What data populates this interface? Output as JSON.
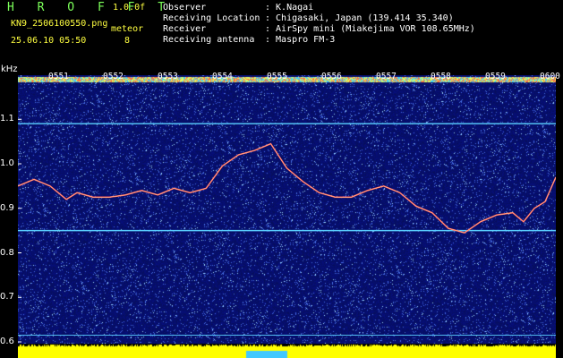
{
  "header": {
    "app_title": "H R O F F T",
    "version": "1.0.0f",
    "file_name": "KN9_2506100550.png",
    "datetime": "25.06.10 05:50",
    "meteor_label": "meteor",
    "meteor_count": "8",
    "info": [
      {
        "label": "Observer",
        "value": ": K.Nagai"
      },
      {
        "label": "Receiving Location",
        "value": ": Chigasaki, Japan (139.414 35.340)"
      },
      {
        "label": "Receiver",
        "value": ": AirSpy mini (Miakejima VOR 108.65MHz)"
      },
      {
        "label": "Receiving antenna",
        "value": ": Maspro FM-3"
      }
    ]
  },
  "chart_data": {
    "type": "spectrogram",
    "ylabel": "kHz",
    "yticks": [
      "1.1",
      "1.0",
      "0.9",
      "0.8",
      "0.7",
      "0.6"
    ],
    "ylim": [
      0.6,
      1.2
    ],
    "time_ticks": [
      "0551",
      "0552",
      "0553",
      "0554",
      "0555",
      "0556",
      "0557",
      "0558",
      "0559",
      "0600"
    ],
    "carrier_lines_khz": [
      1.09,
      0.85,
      0.615
    ],
    "doppler_trace": {
      "t_minutes": [
        0.0,
        0.3,
        0.6,
        0.9,
        1.1,
        1.4,
        1.7,
        2.0,
        2.3,
        2.6,
        2.9,
        3.2,
        3.5,
        3.8,
        4.1,
        4.4,
        4.7,
        5.0,
        5.3,
        5.6,
        5.9,
        6.2,
        6.5,
        6.8,
        7.1,
        7.4,
        7.7,
        8.0,
        8.3,
        8.6,
        8.9,
        9.2,
        9.4,
        9.6,
        9.8,
        10.0
      ],
      "freq_khz": [
        0.95,
        0.965,
        0.95,
        0.92,
        0.935,
        0.925,
        0.925,
        0.93,
        0.94,
        0.93,
        0.945,
        0.935,
        0.945,
        0.995,
        1.02,
        1.03,
        1.045,
        0.99,
        0.96,
        0.935,
        0.925,
        0.925,
        0.94,
        0.95,
        0.935,
        0.905,
        0.89,
        0.855,
        0.845,
        0.87,
        0.885,
        0.89,
        0.87,
        0.9,
        0.915,
        0.97
      ]
    },
    "colors": {
      "background": "#06106e",
      "trace": "#ff5a5a",
      "carrier": "#5ad0ff",
      "footer": "#ffff00",
      "footer_marker": "#40c8ff"
    }
  }
}
